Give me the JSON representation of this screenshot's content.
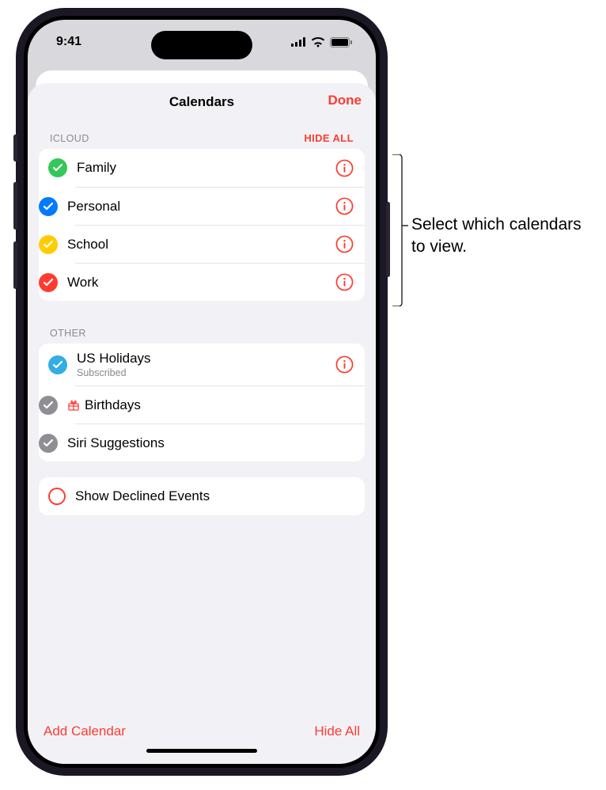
{
  "status": {
    "time": "9:41"
  },
  "sheet": {
    "title": "Calendars",
    "done": "Done"
  },
  "sections": {
    "icloud": {
      "header": "iCloud",
      "action": "Hide All",
      "items": [
        {
          "label": "Family",
          "color": "#34c759"
        },
        {
          "label": "Personal",
          "color": "#007aff"
        },
        {
          "label": "School",
          "color": "#ffcc00"
        },
        {
          "label": "Work",
          "color": "#ff3b30"
        }
      ]
    },
    "other": {
      "header": "Other",
      "items": [
        {
          "label": "US Holidays",
          "sub": "Subscribed",
          "color": "#32ade6",
          "info": true
        },
        {
          "label": "Birthdays",
          "color": "#8e8e93",
          "gift": true
        },
        {
          "label": "Siri Suggestions",
          "color": "#8e8e93"
        }
      ]
    }
  },
  "declined": {
    "label": "Show Declined Events"
  },
  "toolbar": {
    "add": "Add Calendar",
    "hide": "Hide All"
  },
  "callout": {
    "text": "Select which calendars to view."
  }
}
